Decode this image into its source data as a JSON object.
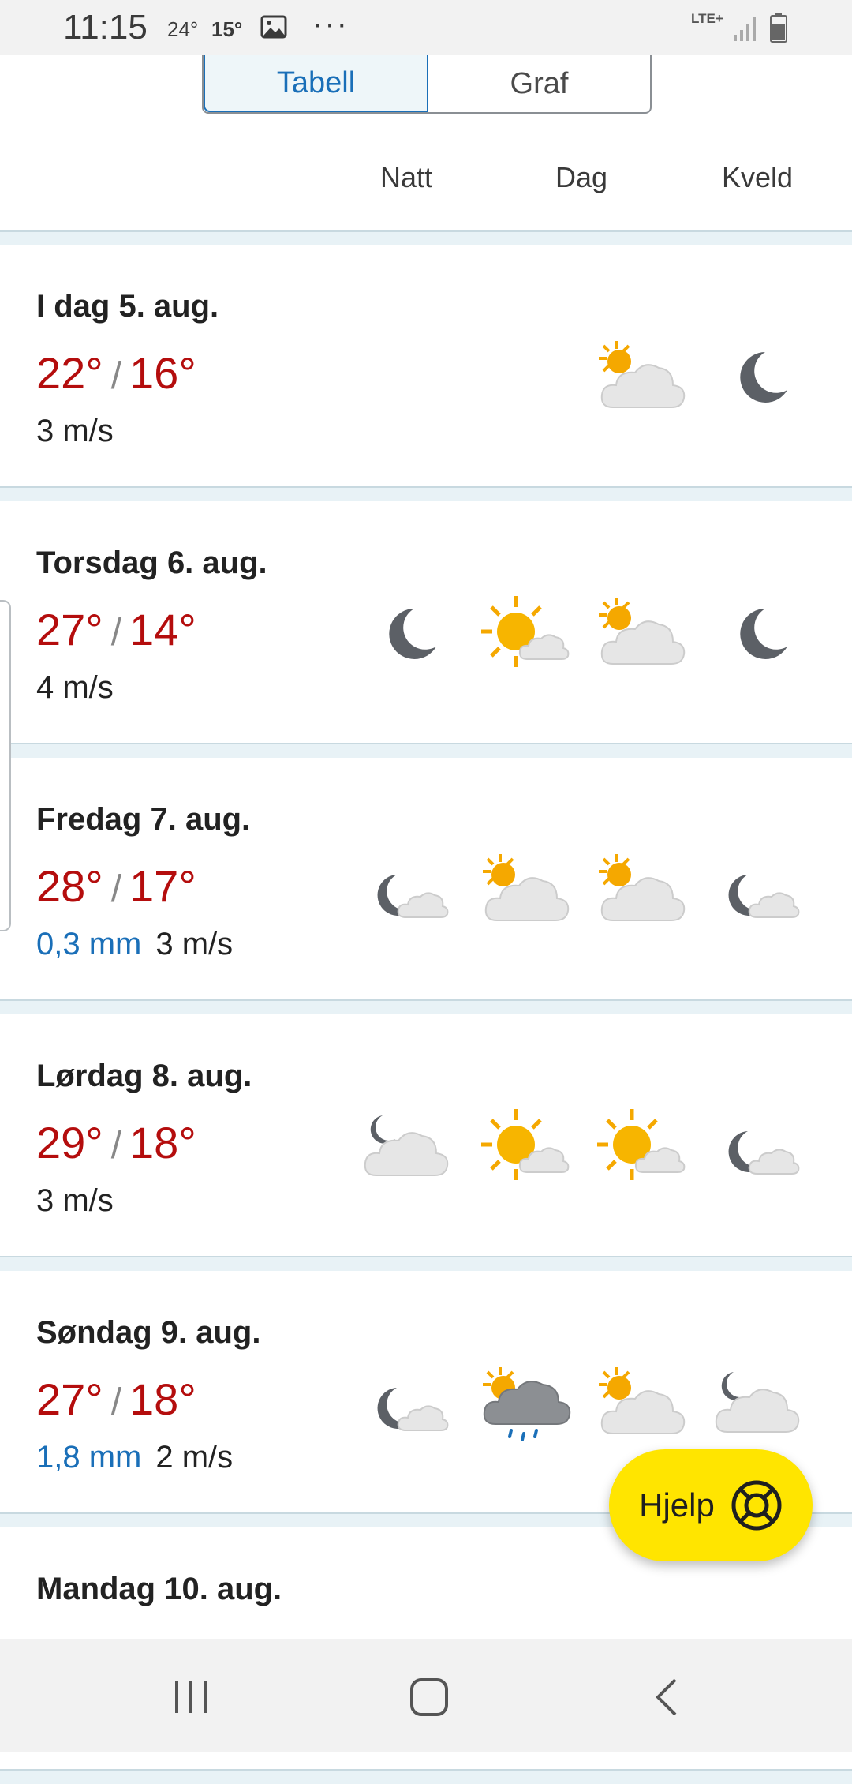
{
  "status_bar": {
    "time": "11:15",
    "temp1": "24°",
    "temp2": "15°",
    "dots": "···",
    "network": "LTE+",
    "icons": [
      "image-icon",
      "signal-icon",
      "battery-icon"
    ]
  },
  "tabs": {
    "table": "Tabell",
    "graph": "Graf",
    "active": "Tabell"
  },
  "columns": {
    "night": "Natt",
    "day": "Dag",
    "evening": "Kveld"
  },
  "days": [
    {
      "title": "I dag 5. aug.",
      "max": "22°",
      "min": "16°",
      "precip": "",
      "wind": "3 m/s",
      "icons": [
        "",
        "",
        "partly-cloudy-day-icon",
        "clear-night-icon"
      ]
    },
    {
      "title": "Torsdag 6. aug.",
      "max": "27°",
      "min": "14°",
      "precip": "",
      "wind": "4 m/s",
      "icons": [
        "clear-night-icon",
        "fair-day-icon",
        "partly-cloudy-day-icon",
        "clear-night-icon"
      ]
    },
    {
      "title": "Fredag 7. aug.",
      "max": "28°",
      "min": "17°",
      "precip": "0,3 mm",
      "wind": "3 m/s",
      "icons": [
        "fair-night-icon",
        "partly-cloudy-day-icon",
        "partly-cloudy-day-icon",
        "fair-night-icon"
      ]
    },
    {
      "title": "Lørdag 8. aug.",
      "max": "29°",
      "min": "18°",
      "precip": "",
      "wind": "3 m/s",
      "icons": [
        "partly-cloudy-night-icon",
        "fair-day-icon",
        "fair-day-icon",
        "fair-night-icon"
      ]
    },
    {
      "title": "Søndag 9. aug.",
      "max": "27°",
      "min": "18°",
      "precip": "1,8 mm",
      "wind": "2 m/s",
      "icons": [
        "fair-night-icon",
        "rain-showers-day-icon",
        "partly-cloudy-day-icon",
        "partly-cloudy-night-icon"
      ]
    },
    {
      "title": "Mandag 10. aug.",
      "max": "",
      "min": "",
      "precip": "",
      "wind": "",
      "icons": [
        "",
        "",
        "",
        ""
      ]
    }
  ],
  "help_button": {
    "label": "Hjelp"
  },
  "colors": {
    "temp": "#b40d0d",
    "precip": "#1a6fb8",
    "accent": "#1a6fb8",
    "help": "#ffe500"
  }
}
